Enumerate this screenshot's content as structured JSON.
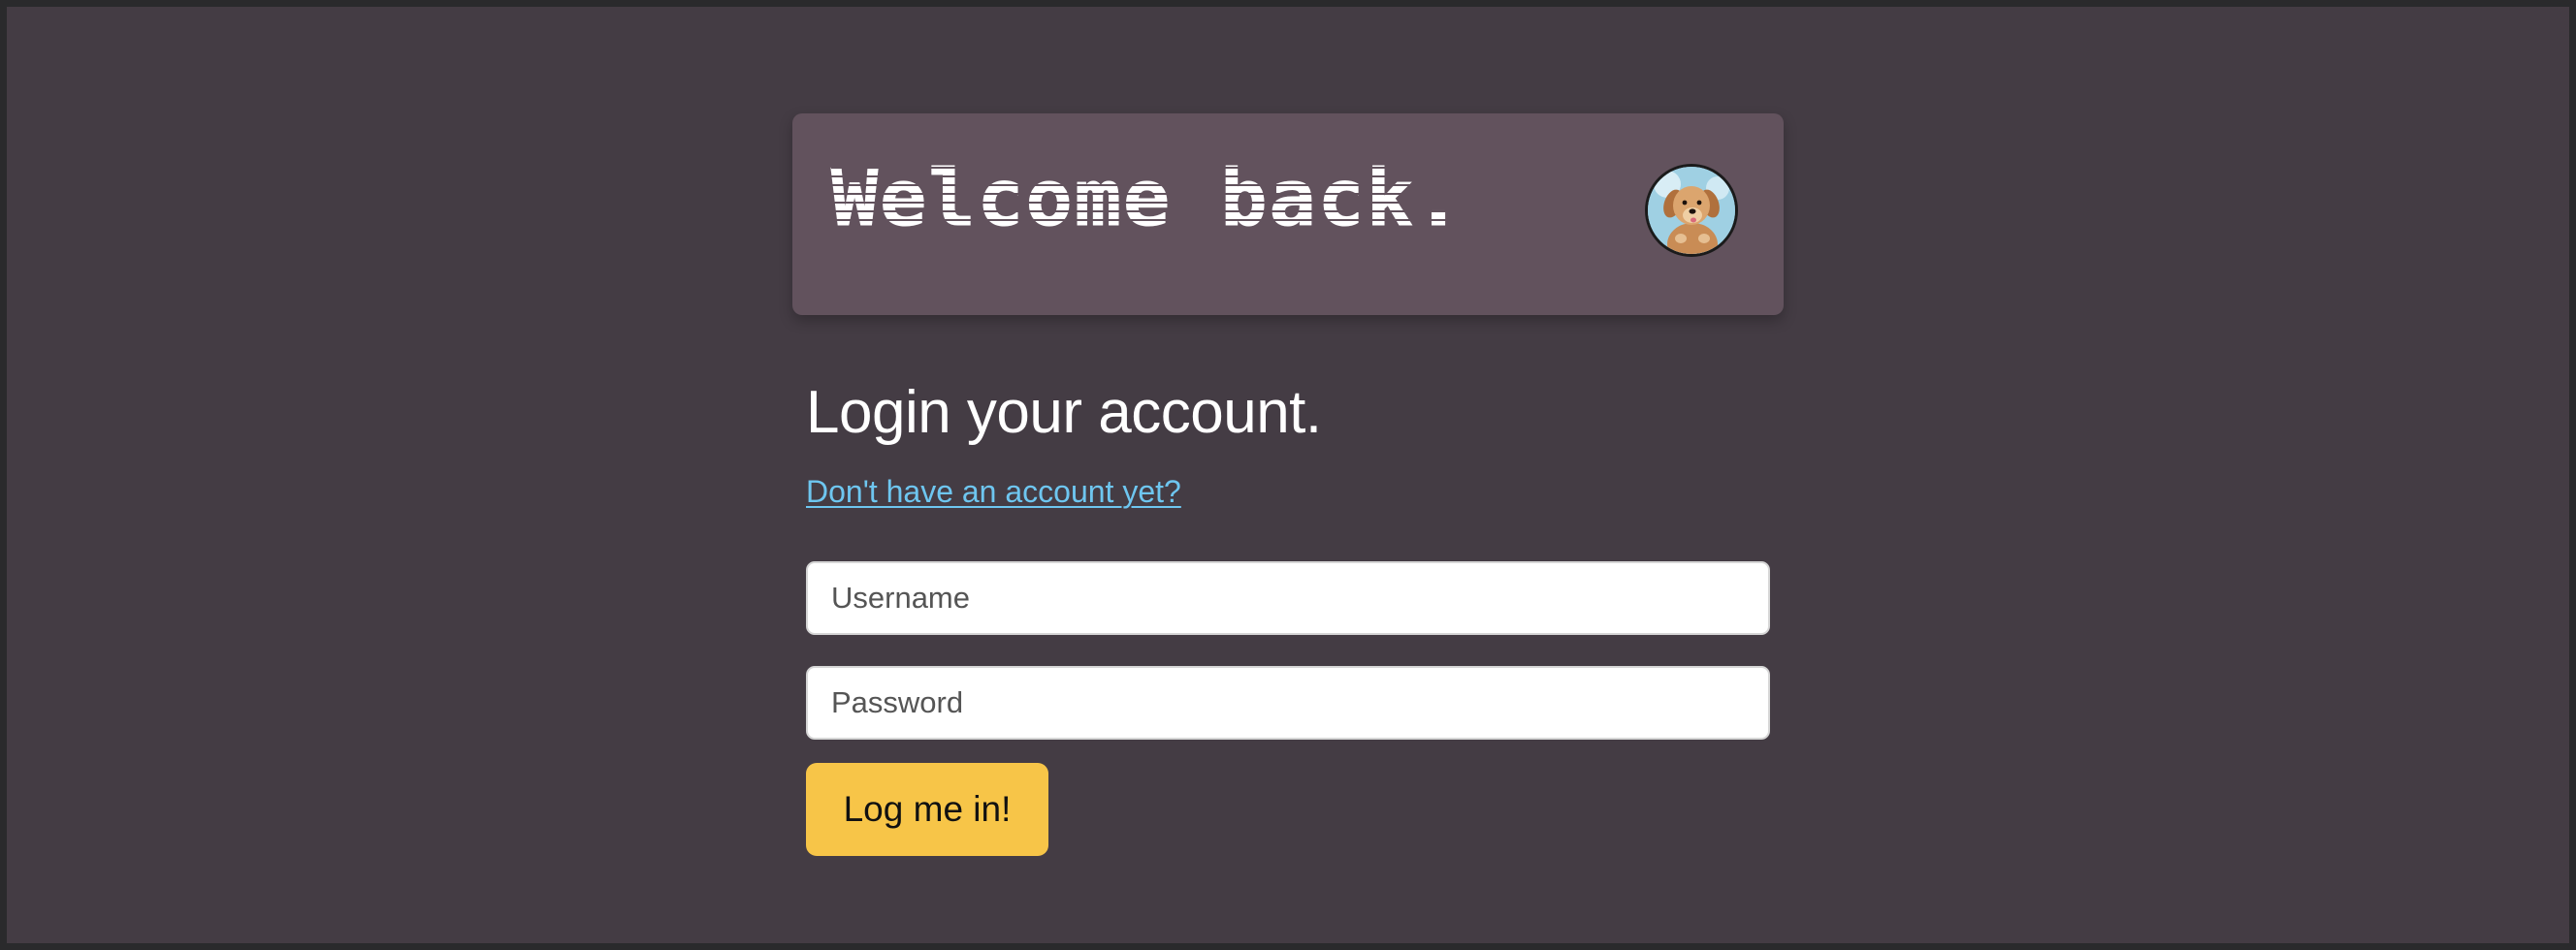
{
  "header": {
    "welcome_text": "Welcome back.",
    "avatar_alt": "golden retriever puppy avatar"
  },
  "login": {
    "title": "Login your account.",
    "signup_link": "Don't have an account yet?",
    "username_placeholder": "Username",
    "password_placeholder": "Password",
    "submit_label": "Log me in!"
  },
  "colors": {
    "page_background": "#443c44",
    "outer_frame": "#2a2a2c",
    "header_card": "#62525d",
    "link": "#6ec6f0",
    "button": "#f7c548"
  }
}
